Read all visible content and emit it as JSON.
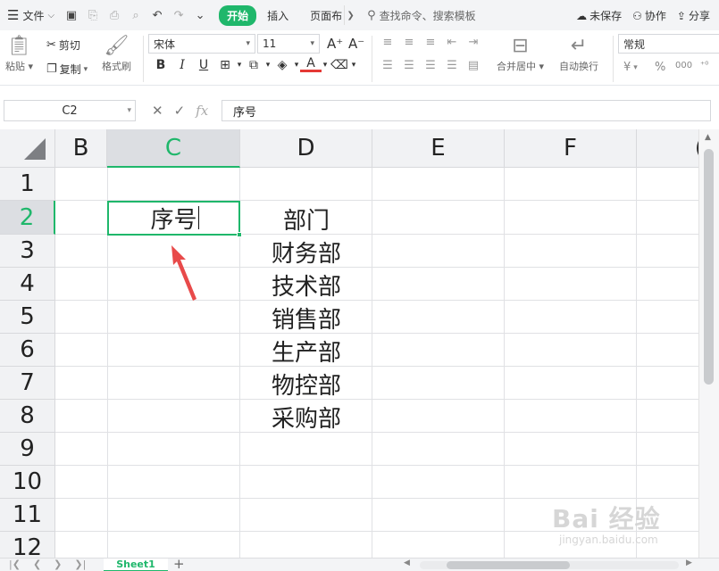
{
  "menubar": {
    "file_label": "文件",
    "tabs": [
      "插入",
      "页面布"
    ],
    "start_tab": "开始",
    "search_placeholder": "查找命令、搜索模板",
    "unsaved_label": "未保存",
    "collab_label": "协作",
    "share_label": "分享"
  },
  "ribbon": {
    "paste_label": "粘贴",
    "cut_label": "剪切",
    "copy_label": "复制",
    "format_painter_label": "格式刷",
    "font_name": "宋体",
    "font_size": "11",
    "merge_center_label": "合并居中",
    "wrap_text_label": "自动换行",
    "number_format": "常规",
    "bold": "B",
    "italic": "I",
    "underline": "U",
    "currency": "¥",
    "percent": "%"
  },
  "formula_bar": {
    "name_box": "C2",
    "fx_label": "fx",
    "content": "序号"
  },
  "sheet": {
    "columns": [
      "B",
      "C",
      "D",
      "E",
      "F"
    ],
    "rows": [
      "1",
      "2",
      "3",
      "4",
      "5",
      "6",
      "7",
      "8",
      "9",
      "10",
      "11",
      "12"
    ],
    "active_column": "C",
    "active_row": "2",
    "cells": {
      "C2": "序号",
      "D2": "部门",
      "D3": "财务部",
      "D4": "技术部",
      "D5": "销售部",
      "D6": "生产部",
      "D7": "物控部",
      "D8": "采购部"
    },
    "tab_name": "Sheet1"
  },
  "watermark": {
    "text1": "Bai 经验",
    "text2": "jingyan.baidu.com"
  },
  "colors": {
    "accent": "#1fb76b",
    "arrow": "#e84a4a"
  }
}
